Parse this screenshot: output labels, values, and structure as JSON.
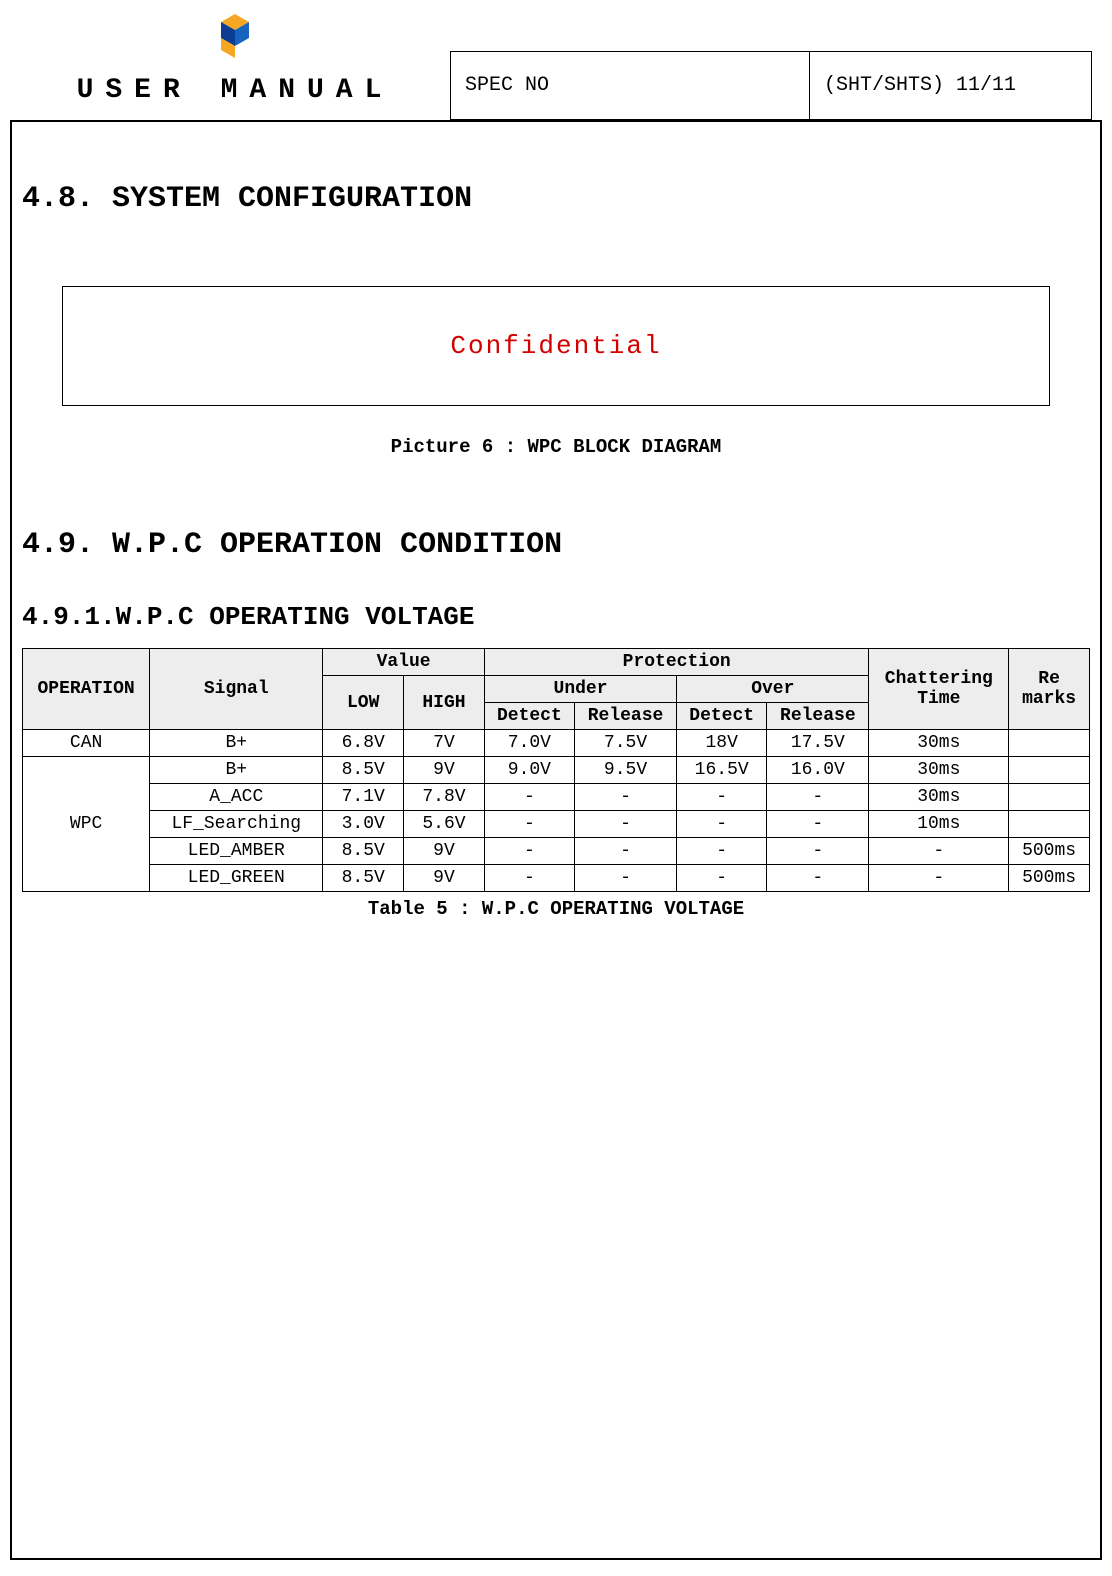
{
  "header": {
    "title": "USER MANUAL",
    "spec_label": "SPEC NO",
    "sht_label": "(SHT/SHTS)  11/11"
  },
  "section48": {
    "heading": "4.8.  SYSTEM CONFIGURATION",
    "confidential": "Confidential",
    "picture_caption": "Picture 6 : WPC BLOCK DIAGRAM"
  },
  "section49": {
    "heading": "4.9.  W.P.C OPERATION CONDITION",
    "sub_heading": "4.9.1.W.P.C OPERATING VOLTAGE",
    "table_caption": "Table 5 : W.P.C OPERATING VOLTAGE",
    "cols": {
      "operation": "OPERATION",
      "signal": "Signal",
      "value": "Value",
      "low": "LOW",
      "high": "HIGH",
      "protection": "Protection",
      "under": "Under",
      "over": "Over",
      "detect": "Detect",
      "release": "Release",
      "chattering": "Chattering Time",
      "remarks": "Re marks"
    },
    "rows": [
      {
        "op": "CAN",
        "signal": "B+",
        "low": "6.8V",
        "high": "7V",
        "ud": "7.0V",
        "ur": "7.5V",
        "od": "18V",
        "orr": "17.5V",
        "chat": "30ms",
        "rem": ""
      },
      {
        "op": "WPC",
        "signal": "B+",
        "low": "8.5V",
        "high": "9V",
        "ud": "9.0V",
        "ur": "9.5V",
        "od": "16.5V",
        "orr": "16.0V",
        "chat": "30ms",
        "rem": ""
      },
      {
        "op": "",
        "signal": "A_ACC",
        "low": "7.1V",
        "high": "7.8V",
        "ud": "-",
        "ur": "-",
        "od": "-",
        "orr": "-",
        "chat": "30ms",
        "rem": ""
      },
      {
        "op": "",
        "signal": "LF_Searching",
        "low": "3.0V",
        "high": "5.6V",
        "ud": "-",
        "ur": "-",
        "od": "-",
        "orr": "-",
        "chat": "10ms",
        "rem": ""
      },
      {
        "op": "",
        "signal": "LED_AMBER",
        "low": "8.5V",
        "high": "9V",
        "ud": "-",
        "ur": "-",
        "od": "-",
        "orr": "-",
        "chat": "-",
        "rem": "500ms"
      },
      {
        "op": "",
        "signal": "LED_GREEN",
        "low": "8.5V",
        "high": "9V",
        "ud": "-",
        "ur": "-",
        "od": "-",
        "orr": "-",
        "chat": "-",
        "rem": "500ms"
      }
    ]
  }
}
